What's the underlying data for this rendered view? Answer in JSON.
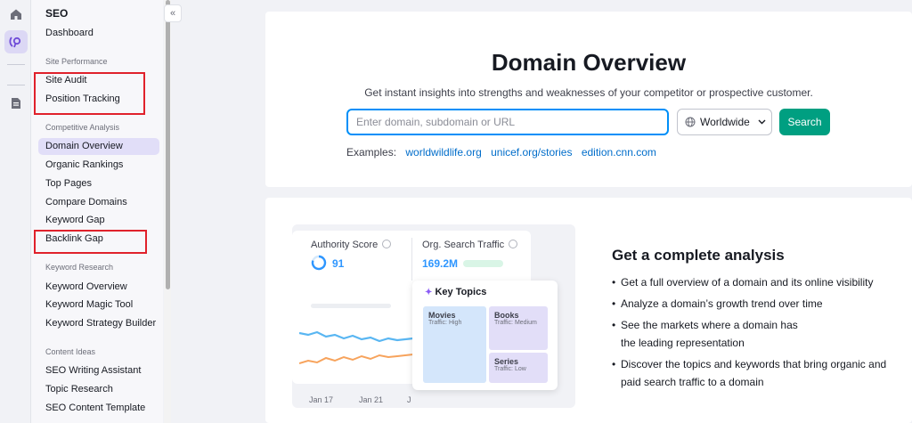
{
  "rail": {
    "icons": [
      "home-icon",
      "seo-toolkit-icon",
      "document-icon"
    ]
  },
  "sidebar": {
    "title": "SEO",
    "dashboard": "Dashboard",
    "groups": {
      "site_performance": "Site Performance",
      "competitive_analysis": "Competitive Analysis",
      "keyword_research": "Keyword Research",
      "content_ideas": "Content Ideas"
    },
    "items": {
      "site_audit": "Site Audit",
      "position_tracking": "Position Tracking",
      "domain_overview": "Domain Overview",
      "organic_rankings": "Organic Rankings",
      "top_pages": "Top Pages",
      "compare_domains": "Compare Domains",
      "keyword_gap": "Keyword Gap",
      "backlink_gap": "Backlink Gap",
      "keyword_overview": "Keyword Overview",
      "keyword_magic_tool": "Keyword Magic Tool",
      "keyword_strategy_builder": "Keyword Strategy Builder",
      "seo_writing_assistant": "SEO Writing Assistant",
      "topic_research": "Topic Research",
      "seo_content_template": "SEO Content Template"
    },
    "active_item": "Domain Overview",
    "highlight_color": "#e0212b"
  },
  "main": {
    "title": "Domain Overview",
    "subtitle": "Get instant insights into strengths and weaknesses of your competitor or prospective customer.",
    "search": {
      "placeholder": "Enter domain, subdomain or URL",
      "value": ""
    },
    "region": "Worldwide",
    "search_button": "Search",
    "examples_label": "Examples:",
    "examples": [
      "worldwildlife.org",
      "unicef.org/stories",
      "edition.cnn.com"
    ],
    "accent_color": "#009f81"
  },
  "analysis": {
    "illustration": {
      "authority_label": "Authority Score",
      "authority_value": "91",
      "traffic_label": "Org. Search Traffic",
      "traffic_value": "169.2M",
      "topics_title": "Key Topics",
      "topics": [
        {
          "name": "Movies",
          "traffic": "Traffic: High"
        },
        {
          "name": "Books",
          "traffic": "Traffic: Medium"
        },
        {
          "name": "Series",
          "traffic": "Traffic: Low"
        }
      ],
      "dates": [
        "Jan 17",
        "Jan 21",
        "J"
      ]
    },
    "heading": "Get a complete analysis",
    "bullets": [
      "Get a full overview of a domain and its online visibility",
      "Analyze a domain’s growth trend over time",
      "See the markets where a domain has\nthe leading representation",
      "Discover the topics and keywords that bring organic and\npaid search traffic to a domain"
    ]
  }
}
